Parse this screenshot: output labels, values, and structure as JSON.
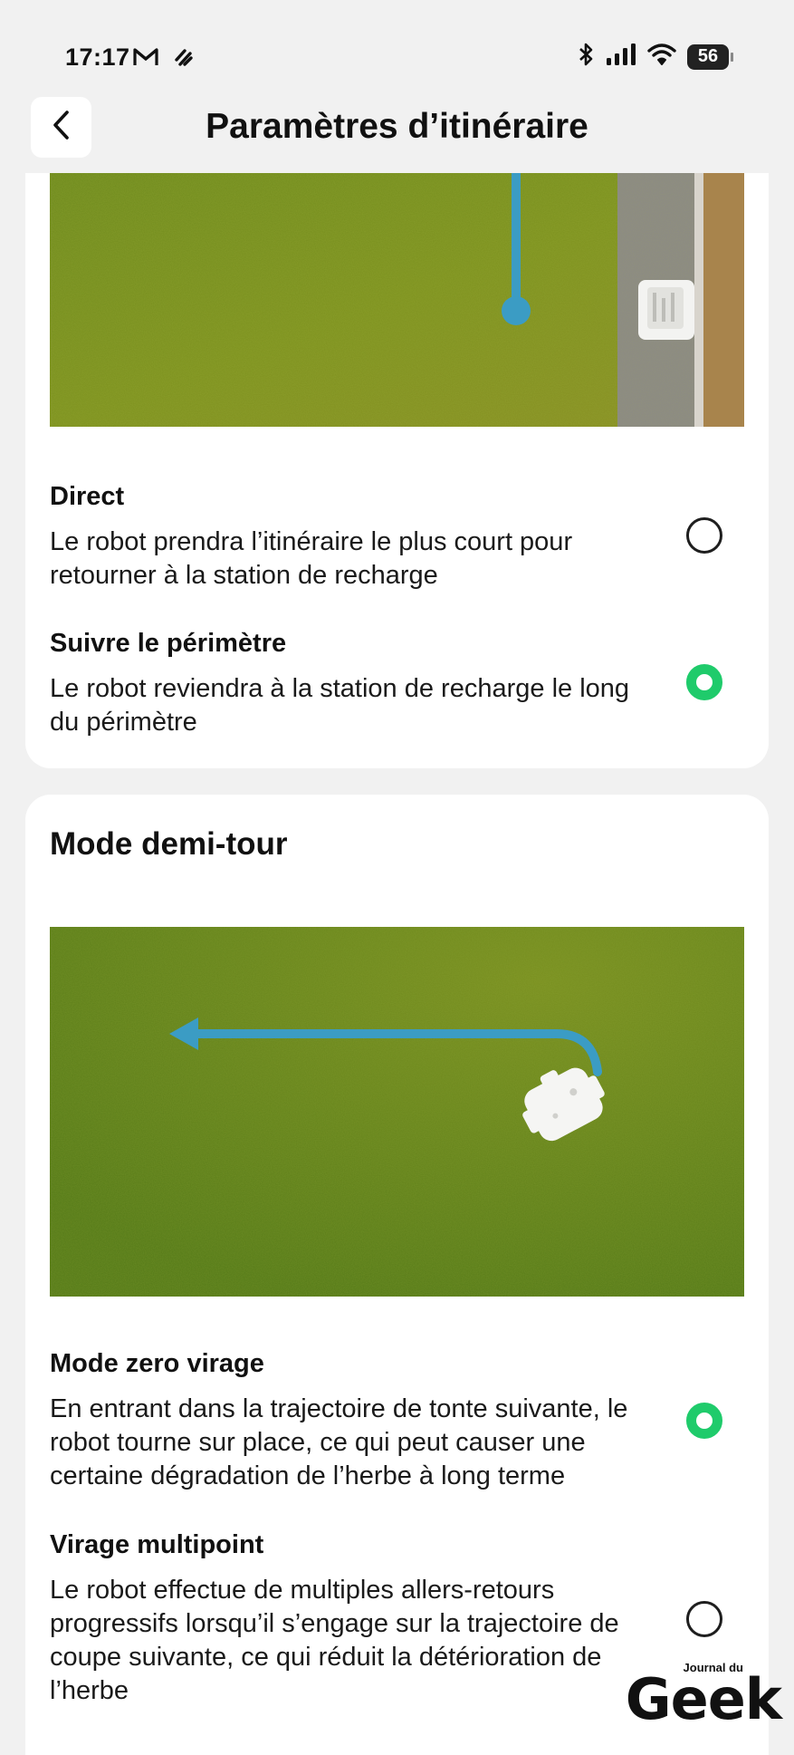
{
  "status_bar": {
    "time": "17:17",
    "battery": "56",
    "left_icons": [
      "gmail-icon",
      "notification-icon"
    ],
    "right_icons": [
      "bluetooth-icon",
      "signal-icon",
      "wifi-icon",
      "battery-icon"
    ]
  },
  "header": {
    "title": "Paramètres d’itinéraire",
    "back_icon": "chevron-left-icon"
  },
  "return_route": {
    "options": [
      {
        "title": "Direct",
        "description": "Le robot prendra l’itinéraire le plus court pour retourner à la station de recharge",
        "selected": false
      },
      {
        "title": "Suivre le périmètre",
        "description": "Le robot reviendra à la station de recharge le long du périmètre",
        "selected": true
      }
    ]
  },
  "turn_mode": {
    "title": "Mode demi-tour",
    "options": [
      {
        "title": "Mode zero virage",
        "description": "En entrant dans la trajectoire de tonte suivante, le robot tourne sur place, ce qui peut causer une certaine dégradation de l’herbe à long terme",
        "selected": true
      },
      {
        "title": "Virage multipoint",
        "description": "Le robot effectue de multiples allers-retours progressifs lorsqu’il s’engage sur la trajectoire de coupe suivante, ce qui réduit la détérioration de l’herbe",
        "selected": false
      }
    ]
  },
  "watermark": {
    "small": "Journal du",
    "big": "Geek"
  },
  "colors": {
    "background": "#f1f1f1",
    "card": "#ffffff",
    "selected_radio": "#1fcb6b",
    "path_blue": "#3b9cc4",
    "grass": "#6f8a1c"
  }
}
